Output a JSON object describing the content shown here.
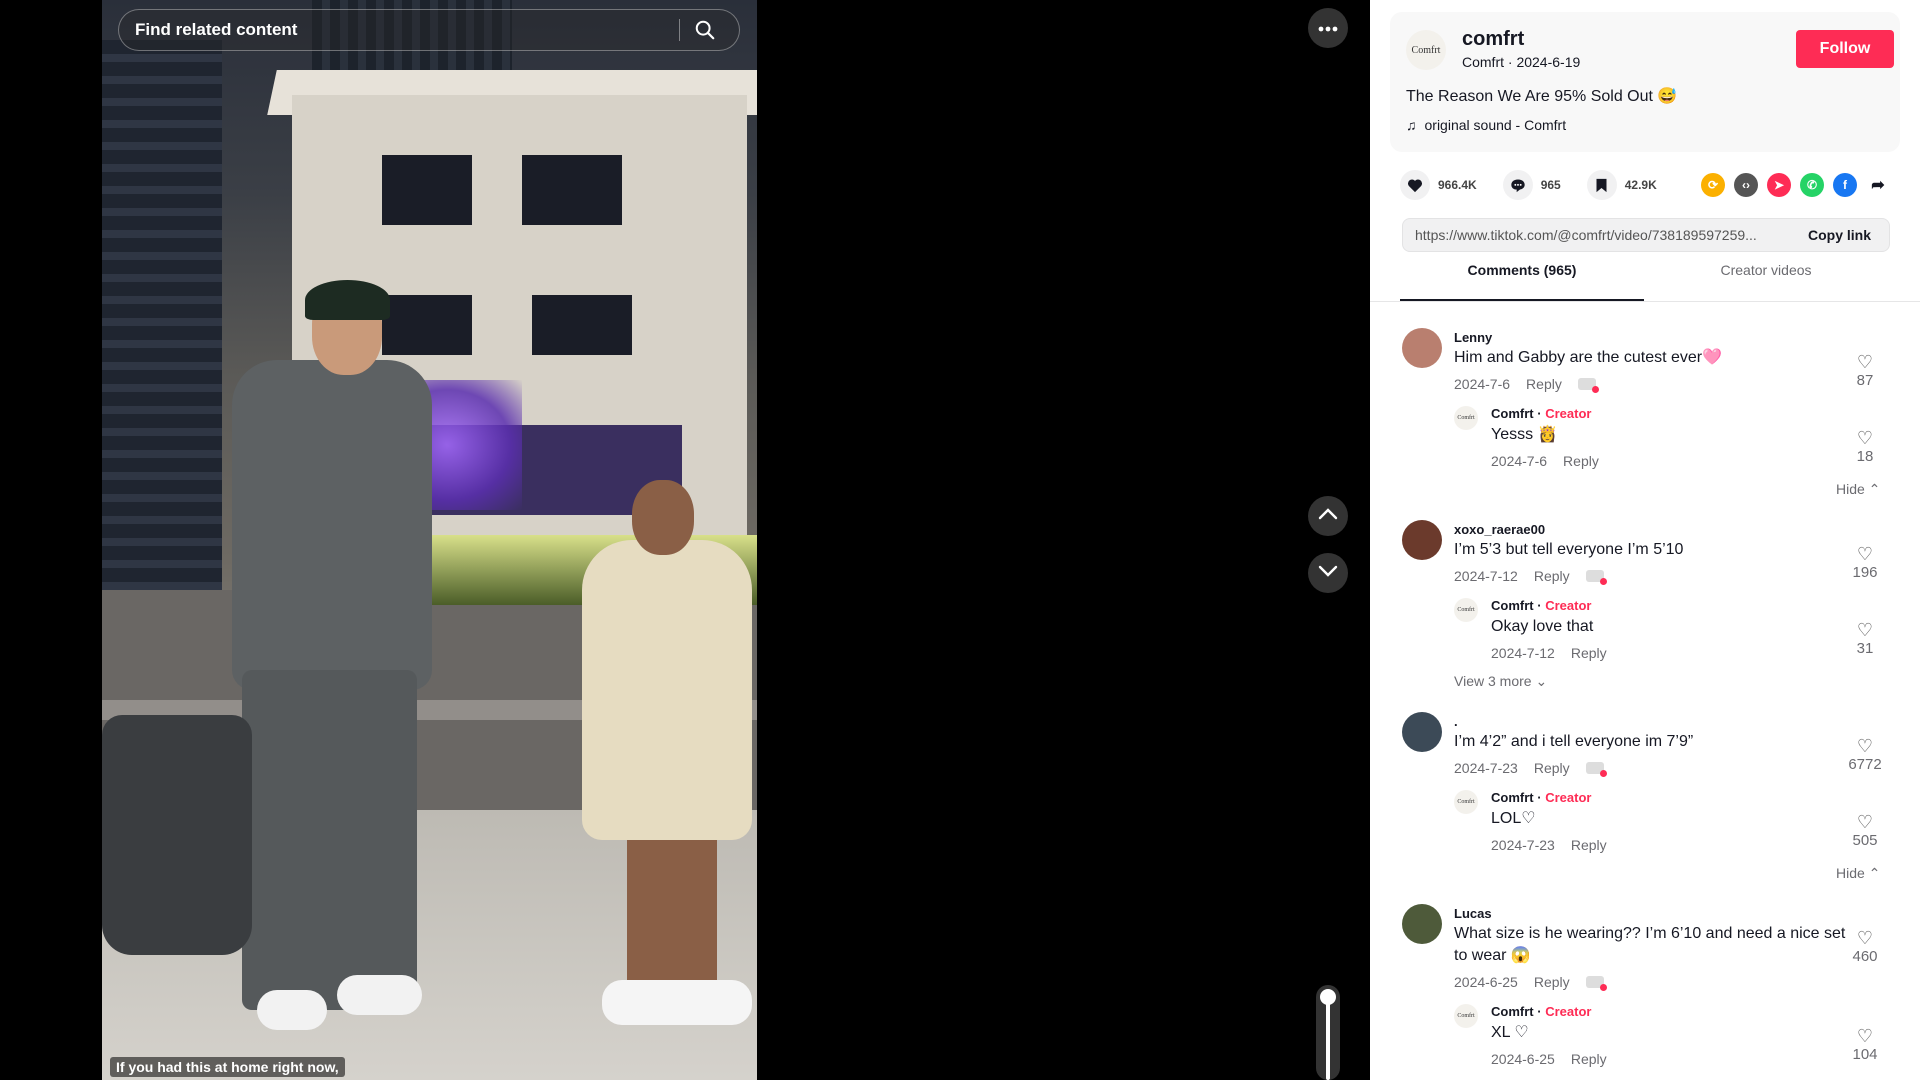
{
  "search": {
    "placeholder": "Find related content"
  },
  "video": {
    "caption": "If you had this at home right now,"
  },
  "author": {
    "avatar_text": "Comfrt",
    "name": "comfrt",
    "sub": "Comfrt · 2024-6-19",
    "follow_label": "Follow",
    "description": "The Reason We Are 95% Sold Out 😅",
    "sound": "original sound - Comfrt"
  },
  "stats": {
    "likes": "966.4K",
    "comments": "965",
    "saves": "42.9K"
  },
  "link": {
    "url": "https://www.tiktok.com/@comfrt/video/738189597259...",
    "copy_label": "Copy link"
  },
  "tabs": {
    "comments": "Comments (965)",
    "creator": "Creator videos"
  },
  "labels": {
    "reply": "Reply",
    "hide": "Hide ⌃",
    "creator": "Creator",
    "creator_sep": "·"
  },
  "comments": [
    {
      "user": "Lenny",
      "text": "Him and Gabby are the cutest ever🩷",
      "date": "2024-7-6",
      "likes": "87",
      "reply": {
        "user": "Comfrt",
        "text": "Yesss 👸",
        "date": "2024-7-6",
        "likes": "18"
      }
    },
    {
      "user": "xoxo_raerae00",
      "text": "I’m 5’3 but tell everyone I’m 5’10",
      "date": "2024-7-12",
      "likes": "196",
      "reply": {
        "user": "Comfrt",
        "text": "Okay love that",
        "date": "2024-7-12",
        "likes": "31"
      },
      "view_more": "View 3 more ⌄"
    },
    {
      "user": ".",
      "text": "I’m 4’2” and i tell everyone im 7’9”",
      "date": "2024-7-23",
      "likes": "6772",
      "reply": {
        "user": "Comfrt",
        "text": "LOL♡",
        "date": "2024-7-23",
        "likes": "505"
      }
    },
    {
      "user": "Lucas",
      "text": "What size is he wearing?? I’m 6’10 and need a nice set to wear 😱",
      "date": "2024-6-25",
      "likes": "460",
      "reply": {
        "user": "Comfrt",
        "text": "XL ♡",
        "date": "2024-6-25",
        "likes": "104"
      }
    }
  ],
  "icons": {
    "more": "ellipsis-icon",
    "up": "chevron-up-icon",
    "down": "chevron-down-icon",
    "search": "search-icon",
    "heart": "heart-icon",
    "comment": "comment-icon",
    "bookmark": "bookmark-icon"
  },
  "colors": {
    "accent": "#fe2c55",
    "panel_bg": "#ffffff",
    "stage_bg": "#000000"
  }
}
